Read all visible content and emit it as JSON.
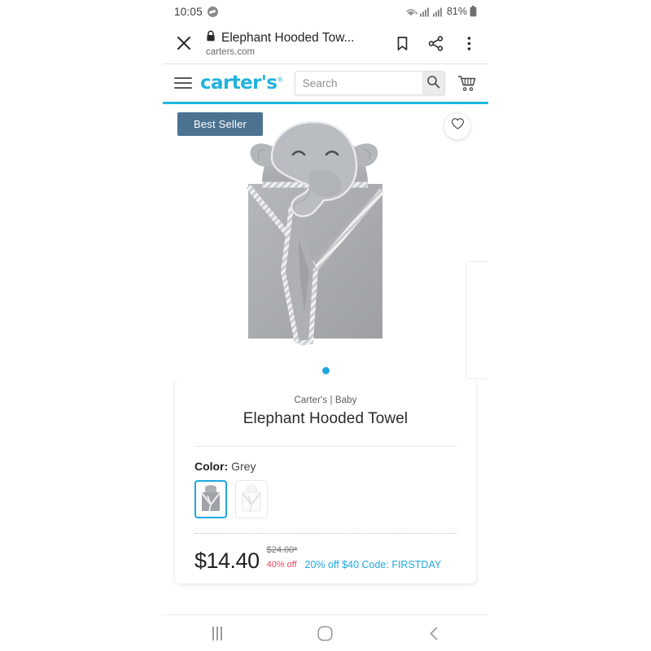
{
  "status_bar": {
    "time": "10:05",
    "messenger_icon": "messenger-icon",
    "wifi_icon": "wifi-icon",
    "signal_icon_1": "signal-bars-icon",
    "signal_icon_2": "signal-bars-icon",
    "battery_percent": "81%",
    "battery_icon": "battery-icon"
  },
  "browser_toolbar": {
    "close_label": "close-icon",
    "lock_label": "lock-icon",
    "page_title": "Elephant Hooded Tow...",
    "host": "carters.com",
    "bookmark_label": "bookmark-icon",
    "share_label": "share-icon",
    "overflow_label": "more-vertical-icon"
  },
  "site_header": {
    "menu_label": "hamburger-menu-icon",
    "logo_text": "carter's",
    "logo_mark": "®",
    "search_placeholder": "Search",
    "search_value": "",
    "search_button_label": "search-icon",
    "cart_label": "cart-icon",
    "accent_color": "#20b3dd"
  },
  "gallery": {
    "badge_text": "Best Seller",
    "badge_color": "#4b7391",
    "wishlist_label": "heart-icon",
    "image_alt": "Grey elephant hooded towel",
    "dots": [
      {
        "active": true
      }
    ],
    "dot_color": "#1fa8e0"
  },
  "product": {
    "breadcrumb": "Carter's | Baby",
    "title": "Elephant Hooded Towel",
    "color_label": "Color:",
    "color_value": "Grey",
    "swatches": [
      {
        "name": "Grey",
        "selected": true
      },
      {
        "name": "White",
        "selected": false
      }
    ],
    "price": "$14.40",
    "was_price": "$24.00*",
    "discount": "40% off",
    "promo": "20% off $40 Code: FIRSTDAY",
    "promo_color": "#1fa8e0",
    "discount_color": "#e2445c"
  },
  "android_nav": {
    "recents_label": "recents-icon",
    "home_label": "home-icon",
    "back_label": "back-icon"
  }
}
